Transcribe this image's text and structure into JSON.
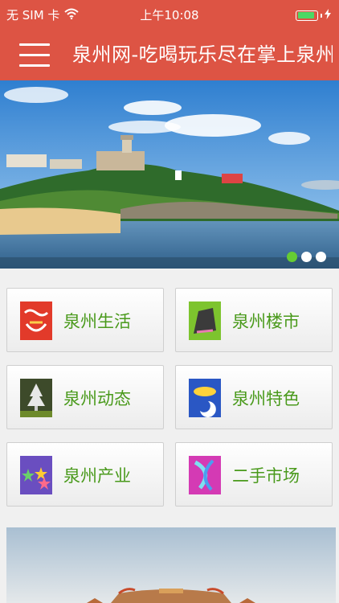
{
  "status_bar": {
    "carrier": "无 SIM 卡",
    "wifi_icon": "wifi-icon",
    "time": "上午10:08",
    "battery_icon": "battery-icon",
    "battery_level": 0.9,
    "charging_icon": "bolt-icon"
  },
  "navbar": {
    "menu_icon": "menu-icon",
    "title": "泉州网-吃喝玩乐尽在掌上泉州",
    "background": "#dd5444"
  },
  "banner": {
    "image": "coastal-lighthouse-photo",
    "page_indicator": {
      "count": 3,
      "active": 0,
      "active_color": "#66cc33"
    }
  },
  "tiles": [
    {
      "label": "泉州生活",
      "icon": "life-icon"
    },
    {
      "label": "泉州楼市",
      "icon": "real-estate-icon"
    },
    {
      "label": "泉州动态",
      "icon": "news-icon"
    },
    {
      "label": "泉州特色",
      "icon": "specialty-icon"
    },
    {
      "label": "泉州产业",
      "icon": "industry-icon"
    },
    {
      "label": "二手市场",
      "icon": "secondhand-market-icon"
    }
  ],
  "bottom_photo": {
    "image": "temple-roof-photo"
  },
  "colors": {
    "accent": "#dd5444",
    "tile_text": "#4a9a1c"
  }
}
